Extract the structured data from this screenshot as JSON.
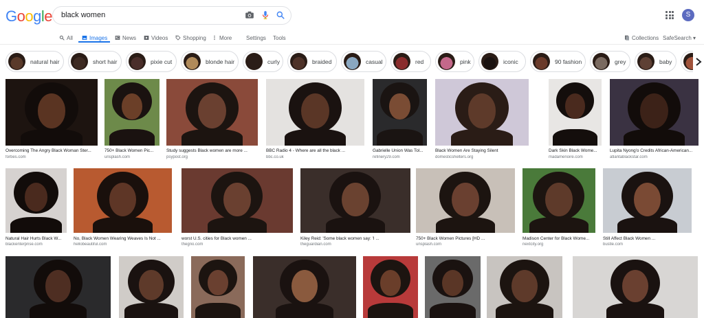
{
  "header": {
    "logo_letters": [
      {
        "ch": "G",
        "color": "#4285F4"
      },
      {
        "ch": "o",
        "color": "#EA4335"
      },
      {
        "ch": "o",
        "color": "#FBBC05"
      },
      {
        "ch": "g",
        "color": "#4285F4"
      },
      {
        "ch": "l",
        "color": "#34A853"
      },
      {
        "ch": "e",
        "color": "#EA4335"
      }
    ],
    "search_query": "black women",
    "avatar_initial": "S",
    "icons": [
      "camera-icon",
      "microphone-icon",
      "search-icon",
      "apps-grid-icon"
    ]
  },
  "tabs": {
    "all": "All",
    "images": "Images",
    "news": "News",
    "videos": "Videos",
    "shopping": "Shopping",
    "more": "More",
    "settings": "Settings",
    "tools": "Tools",
    "collections": "Collections",
    "safesearch": "SafeSearch ▾"
  },
  "chips": [
    {
      "label": "natural hair",
      "color": "#5a3a2a"
    },
    {
      "label": "short hair",
      "color": "#3d2a22"
    },
    {
      "label": "pixie cut",
      "color": "#4a2e2a"
    },
    {
      "label": "blonde hair",
      "color": "#b08a5a"
    },
    {
      "label": "curly",
      "color": "#2b1d18"
    },
    {
      "label": "braided",
      "color": "#4e3228"
    },
    {
      "label": "casual",
      "color": "#8aa7c0"
    },
    {
      "label": "red",
      "color": "#8a2c2c"
    },
    {
      "label": "pink",
      "color": "#c4688a"
    },
    {
      "label": "iconic",
      "color": "#1a1210"
    },
    {
      "label": "90 fashion",
      "color": "#6a3a2a"
    },
    {
      "label": "grey",
      "color": "#7a6a60"
    },
    {
      "label": "baby",
      "color": "#5e4034"
    },
    {
      "label": "",
      "color": "#a0523a"
    }
  ],
  "rows": [
    [
      {
        "caption": "Overcoming The Angry Black Woman Ster...",
        "source": "forbes.com",
        "bg": "#1d1410",
        "skin": "#5a3422",
        "hair": "#120c0a"
      },
      {
        "caption": "750+ Black Women Pic...",
        "source": "unsplash.com",
        "bg": "#6d8a4a",
        "skin": "#6b3f28",
        "hair": "#1a1210"
      },
      {
        "caption": "Study suggests Black women are more ...",
        "source": "psypost.org",
        "bg": "#8a4a3a",
        "skin": "#6a4030",
        "hair": "#1c1410"
      },
      {
        "caption": "BBC Radio 4 - Where are all the black ...",
        "source": "bbc.co.uk",
        "bg": "#e4e2e0",
        "skin": "#5a3626",
        "hair": "#1a1210"
      },
      {
        "caption": "Gabrielle Union Was Tol...",
        "source": "refinery29.com",
        "bg": "#2a2a2c",
        "skin": "#7a4c34",
        "hair": "#1a1412"
      },
      {
        "caption": "Black Women Are Staying Silent",
        "source": "domesticshelters.org",
        "bg": "#cfc8d8",
        "skin": "#5e3a2a",
        "hair": "#2a1c16"
      },
      {
        "caption": "Dark Skin Black Wome...",
        "source": "madamenoire.com",
        "bg": "#e8e6e4",
        "skin": "#4a2a1e",
        "hair": "#140e0c"
      },
      {
        "caption": "Lupita Nyong'o Credits African-American...",
        "source": "atlantablackstar.com",
        "bg": "#3a3242",
        "skin": "#3c2218",
        "hair": "#120c0a"
      }
    ],
    [
      {
        "caption": "Natural Hair Hurts Black W...",
        "source": "blackenterprise.com",
        "bg": "#d6d2d0",
        "skin": "#4a2a1e",
        "hair": "#120c0a"
      },
      {
        "caption": "No, Black Women Wearing Weaves Is Not ...",
        "source": "hellobeautiful.com",
        "bg": "#b85a30",
        "skin": "#5e3626",
        "hair": "#1a100c"
      },
      {
        "caption": "worst U.S. cities for Black women ...",
        "source": "thegrio.com",
        "bg": "#6a3a30",
        "skin": "#6a4030",
        "hair": "#1c1410"
      },
      {
        "caption": "Kiley Reid: 'Some black women say: 'I ...",
        "source": "theguardian.com",
        "bg": "#3a2e2a",
        "skin": "#6a4230",
        "hair": "#1a1210"
      },
      {
        "caption": "750+ Black Women Pictures [HD ...",
        "source": "unsplash.com",
        "bg": "#c8c0b8",
        "skin": "#6a4030",
        "hair": "#1c1410"
      },
      {
        "caption": "Madison Center for Black Wome...",
        "source": "nextcity.org",
        "bg": "#4a7a3a",
        "skin": "#5e3a2a",
        "hair": "#1c1410"
      },
      {
        "caption": "Still Affect Black Women ...",
        "source": "bustle.com",
        "bg": "#c8ccd2",
        "skin": "#7a4a34",
        "hair": "#1a1210"
      }
    ],
    [
      {
        "caption": "",
        "source": "",
        "bg": "#2a2a2c",
        "skin": "#4e2e22",
        "hair": "#120c0a"
      },
      {
        "caption": "",
        "source": "",
        "bg": "#d0ccc8",
        "skin": "#5e3a2a",
        "hair": "#1a1210"
      },
      {
        "caption": "",
        "source": "",
        "bg": "#8a6a5a",
        "skin": "#6a4030",
        "hair": "#1c1410"
      },
      {
        "caption": "",
        "source": "",
        "bg": "#3a2e2a",
        "skin": "#8a5a3e",
        "hair": "#1a1210"
      },
      {
        "caption": "",
        "source": "",
        "bg": "#b83a3a",
        "skin": "#6a3e2a",
        "hair": "#1c1410"
      },
      {
        "caption": "",
        "source": "",
        "bg": "#6a6a6a",
        "skin": "#5a3626",
        "hair": "#1a1210"
      },
      {
        "caption": "",
        "source": "",
        "bg": "#c8c4c0",
        "skin": "#5e3a2a",
        "hair": "#1c1410"
      },
      {
        "caption": "",
        "source": "",
        "bg": "#d8d6d4",
        "skin": "#6a4030",
        "hair": "#1a1210"
      }
    ]
  ]
}
